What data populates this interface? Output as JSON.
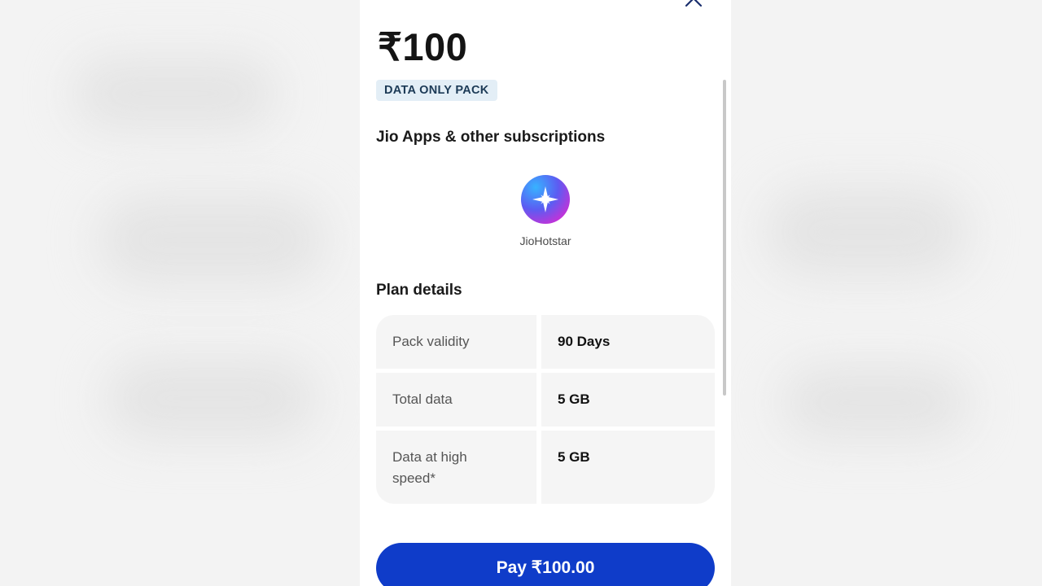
{
  "plan": {
    "price": "₹100",
    "badge": "DATA ONLY PACK"
  },
  "subscriptions": {
    "title": "Jio Apps & other subscriptions",
    "apps": [
      {
        "name": "JioHotstar",
        "icon": "jiohotstar-logo-icon"
      }
    ]
  },
  "plan_details": {
    "title": "Plan details",
    "rows": [
      {
        "label": "Pack validity",
        "value": "90 Days"
      },
      {
        "label": "Total data",
        "value": "5 GB"
      },
      {
        "label": "Data at high speed*",
        "value": "5 GB"
      }
    ]
  },
  "actions": {
    "pay_label": "Pay ₹100.00",
    "close_icon": "close-icon"
  },
  "colors": {
    "primary_button": "#0f3cc9",
    "badge_bg": "#e3eef6",
    "badge_text": "#1c3a56"
  }
}
